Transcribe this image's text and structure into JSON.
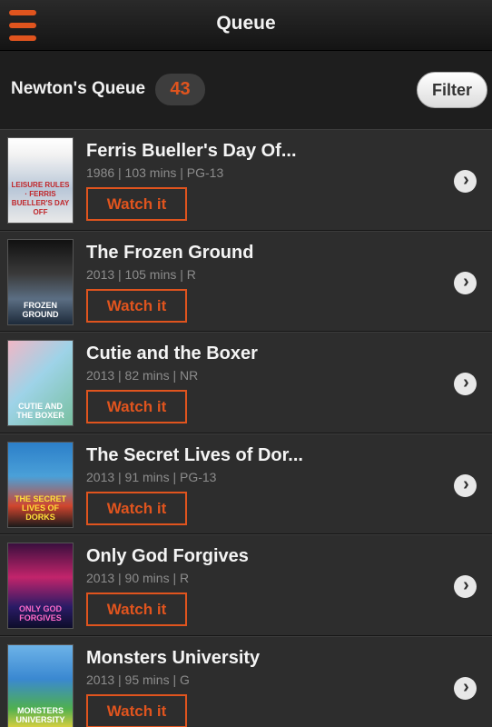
{
  "header": {
    "title": "Queue",
    "menu_icon": "hamburger-icon",
    "accent_color": "#e0541e"
  },
  "queue": {
    "name": "Newton's Queue",
    "count": "43",
    "filter_label": "Filter"
  },
  "movies": [
    {
      "title": "Ferris Bueller's Day Of...",
      "meta": "1986 | 103 mins | PG-13",
      "watch_label": "Watch it",
      "poster_text": "Leisure Rules · Ferris Bueller's Day Off"
    },
    {
      "title": "The Frozen Ground",
      "meta": "2013 | 105 mins | R",
      "watch_label": "Watch it",
      "poster_text": "Frozen Ground"
    },
    {
      "title": "Cutie and the Boxer",
      "meta": "2013 | 82 mins | NR",
      "watch_label": "Watch it",
      "poster_text": "Cutie and the Boxer"
    },
    {
      "title": "The Secret Lives of Dor...",
      "meta": "2013 | 91 mins | PG-13",
      "watch_label": "Watch it",
      "poster_text": "The Secret Lives of Dorks"
    },
    {
      "title": "Only God Forgives",
      "meta": "2013 | 90 mins | R",
      "watch_label": "Watch it",
      "poster_text": "Only God Forgives"
    },
    {
      "title": "Monsters University",
      "meta": "2013 | 95 mins | G",
      "watch_label": "Watch it",
      "poster_text": "Monsters University"
    }
  ]
}
